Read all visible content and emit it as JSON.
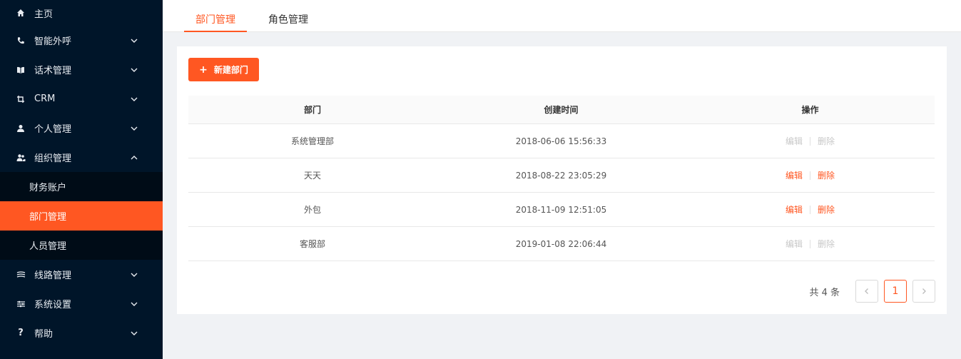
{
  "sidebar": {
    "items": [
      {
        "label": "主页",
        "icon": "home-icon"
      },
      {
        "label": "智能外呼",
        "icon": "phone-icon"
      },
      {
        "label": "话术管理",
        "icon": "book-icon"
      },
      {
        "label": "CRM",
        "icon": "crop-icon"
      },
      {
        "label": "个人管理",
        "icon": "user-icon"
      },
      {
        "label": "组织管理",
        "icon": "team-icon"
      },
      {
        "label": "线路管理",
        "icon": "route-icon"
      },
      {
        "label": "系统设置",
        "icon": "sliders-icon"
      },
      {
        "label": "帮助",
        "icon": "question-icon"
      }
    ],
    "submenu": [
      {
        "label": "财务账户"
      },
      {
        "label": "部门管理"
      },
      {
        "label": "人员管理"
      }
    ]
  },
  "tabs": [
    {
      "label": "部门管理"
    },
    {
      "label": "角色管理"
    }
  ],
  "toolbar": {
    "new_label": "新建部门"
  },
  "table": {
    "headers": [
      "部门",
      "创建时间",
      "操作"
    ],
    "rows": [
      {
        "name": "系统管理部",
        "created": "2018-06-06 15:56:33",
        "edit": "编辑",
        "delete": "删除",
        "enabled": false
      },
      {
        "name": "天天",
        "created": "2018-08-22 23:05:29",
        "edit": "编辑",
        "delete": "删除",
        "enabled": true
      },
      {
        "name": "外包",
        "created": "2018-11-09 12:51:05",
        "edit": "编辑",
        "delete": "删除",
        "enabled": true
      },
      {
        "name": "客服部",
        "created": "2019-01-08 22:06:44",
        "edit": "编辑",
        "delete": "删除",
        "enabled": false
      }
    ]
  },
  "pagination": {
    "total_label": "共 4 条",
    "current": "1"
  },
  "colors": {
    "accent": "#ff5722",
    "sidebar": "#001529",
    "disabled": "#c8c8c8"
  }
}
